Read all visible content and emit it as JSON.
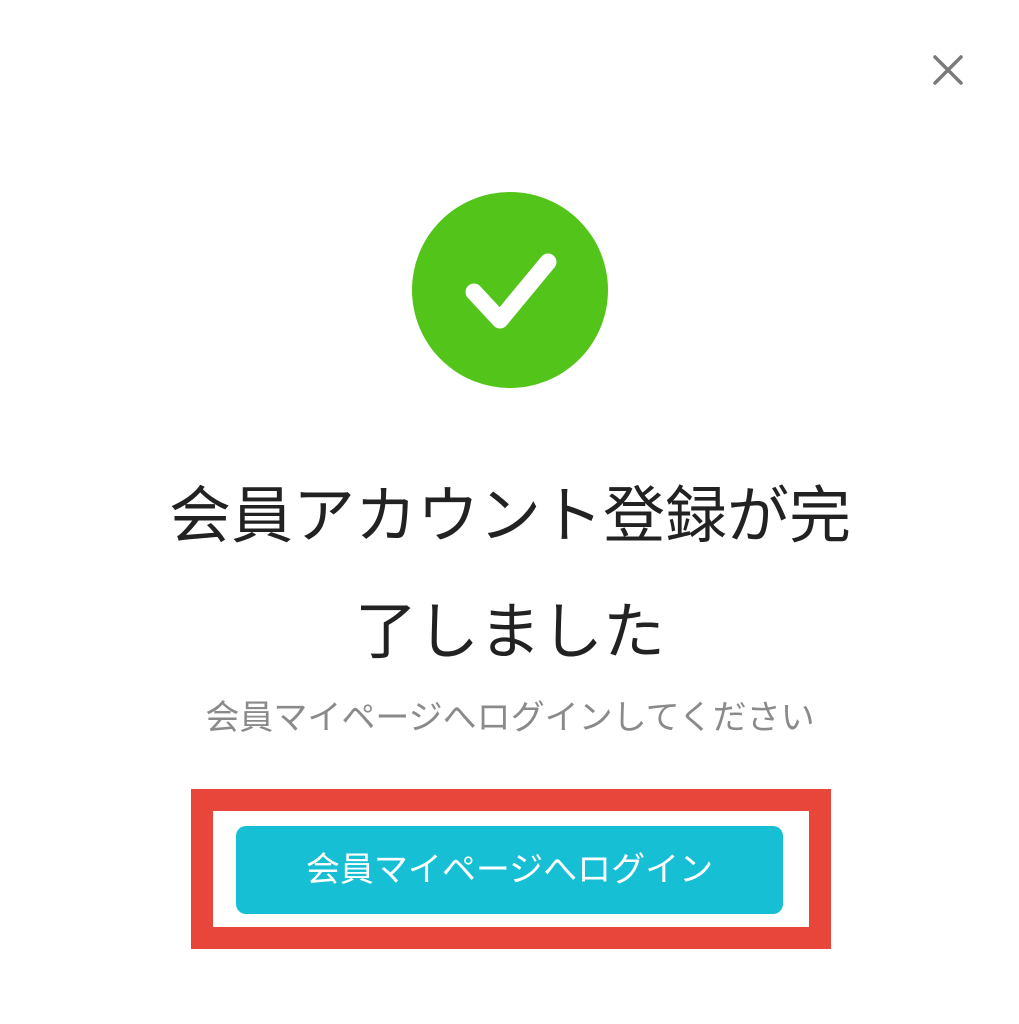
{
  "dialog": {
    "close_icon": "close-icon",
    "success_icon": "check-circle-icon",
    "title_line1": "会員アカウント登録が完",
    "title_line2": "了しました",
    "subtitle": "会員マイページへログインしてください",
    "login_button_label": "会員マイページへログイン"
  },
  "colors": {
    "success": "#52c41a",
    "button": "#16bfd3",
    "highlight": "#e8463a"
  }
}
